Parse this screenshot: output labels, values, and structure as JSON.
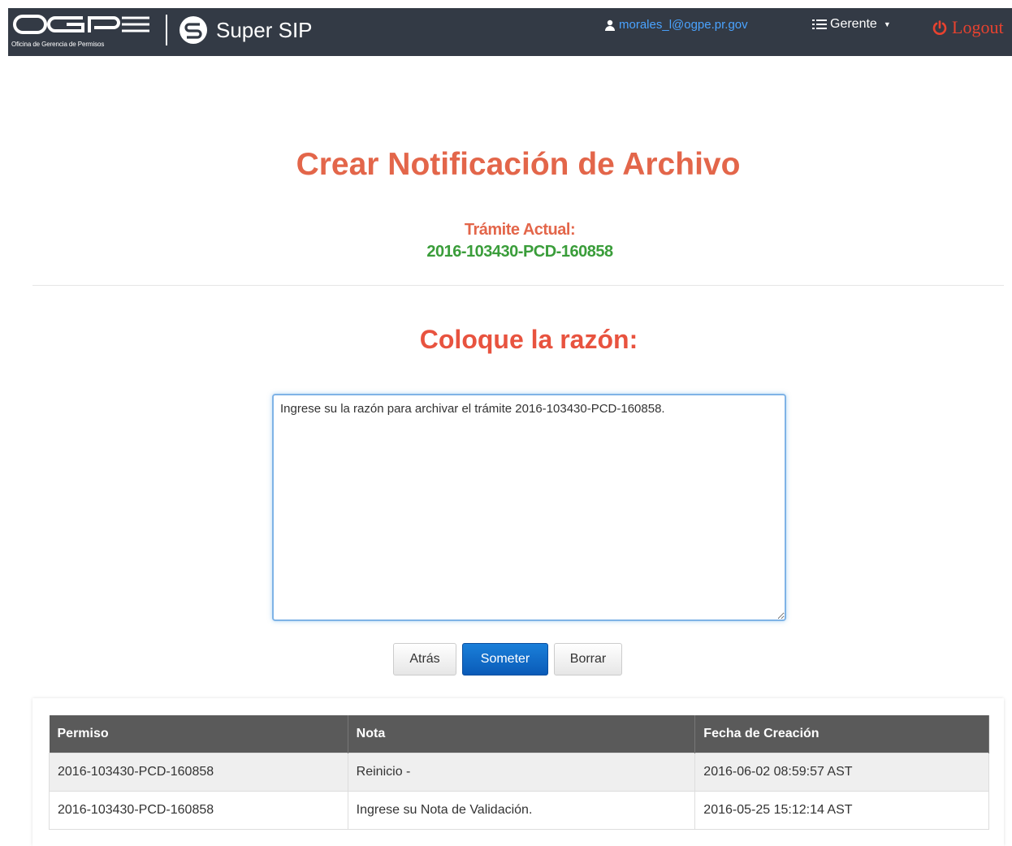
{
  "colors": {
    "navbar_bg": "#333a45",
    "title_accent": "#e3664a",
    "tramite_id": "#3a9d3a",
    "user_link": "#4aa3ff",
    "logout": "#e8422f",
    "primary_button": "#0a5bb8",
    "table_header_bg": "#5a5a5a"
  },
  "navbar": {
    "logo_text": "OGPE",
    "logo_subtitle": "Oficina de Gerencia de Permisos",
    "brand_name": "Super SIP",
    "user_email": "morales_l@ogpe.pr.gov",
    "role_label": "Gerente",
    "logout_label": "Logout",
    "icons": [
      "user-icon",
      "list-icon",
      "caret-down-icon",
      "power-icon"
    ]
  },
  "page": {
    "title": "Crear Notificación de Archivo",
    "current_label": "Trámite Actual:",
    "current_id": "2016-103430-PCD-160858",
    "reason_title": "Coloque la razón:"
  },
  "form": {
    "reason_value": "Ingrese su la razón para archivar el trámite 2016-103430-PCD-160858.",
    "back_label": "Atrás",
    "submit_label": "Someter",
    "clear_label": "Borrar"
  },
  "history_table": {
    "headers": [
      "Permiso",
      "Nota",
      "Fecha de Creación"
    ],
    "rows": [
      [
        "2016-103430-PCD-160858",
        "Reinicio -",
        "2016-06-02 08:59:57 AST"
      ],
      [
        "2016-103430-PCD-160858",
        "Ingrese su Nota de Validación.",
        "2016-05-25 15:12:14 AST"
      ]
    ]
  }
}
